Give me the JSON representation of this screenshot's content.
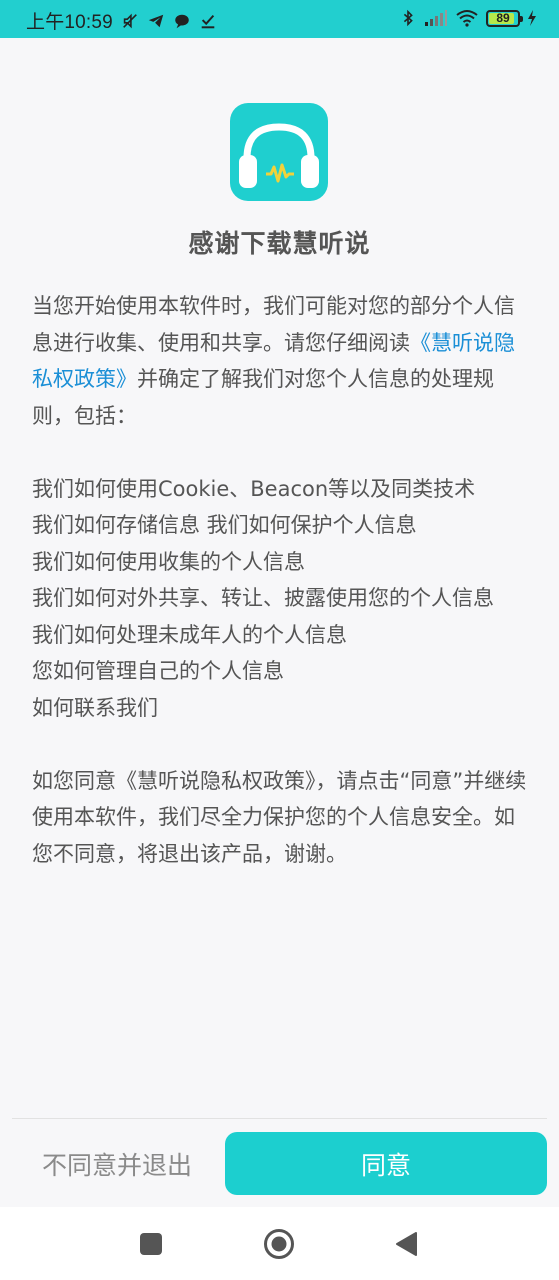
{
  "status_bar": {
    "time": "上午10:59",
    "battery": "89",
    "battery_level": 0.89,
    "left_icons": [
      "mute-icon",
      "telegram-icon",
      "chat-bubble-icon",
      "download-done-icon"
    ],
    "right_icons": [
      "bluetooth-icon",
      "signal-icon",
      "wifi-icon",
      "battery-icon",
      "charging-icon"
    ]
  },
  "dialog": {
    "app_icon": "headphones-icon",
    "title": "感谢下载慧听说",
    "intro_before_link": "当您开始使用本软件时，我们可能对您的部分个人信息进行收集、使用和共享。请您仔细阅读",
    "policy_link": "《慧听说隐私权政策》",
    "intro_after_link": "并确定了解我们对您个人信息的处理规则，包括：",
    "items": [
      "我们如何使用Cookie、Beacon等以及同类技术",
      "我们如何存储信息 我们如何保护个人信息",
      "我们如何使用收集的个人信息",
      "我们如何对外共享、转让、披露使用您的个人信息",
      "我们如何处理未成年人的个人信息",
      "您如何管理自己的个人信息",
      "如何联系我们"
    ],
    "closing": "如您同意《慧听说隐私权政策》，请点击“同意”并继续使用本软件，我们尽全力保护您的个人信息安全。如您不同意，将退出该产品，谢谢。"
  },
  "buttons": {
    "disagree": "不同意并退出",
    "agree": "同意"
  },
  "colors": {
    "accent": "#1ccfcf",
    "link": "#1b8fd6",
    "status_bar": "#22cfcf"
  },
  "nav_bar": {
    "icons": [
      "recents-square-icon",
      "home-circle-icon",
      "back-triangle-icon"
    ]
  }
}
